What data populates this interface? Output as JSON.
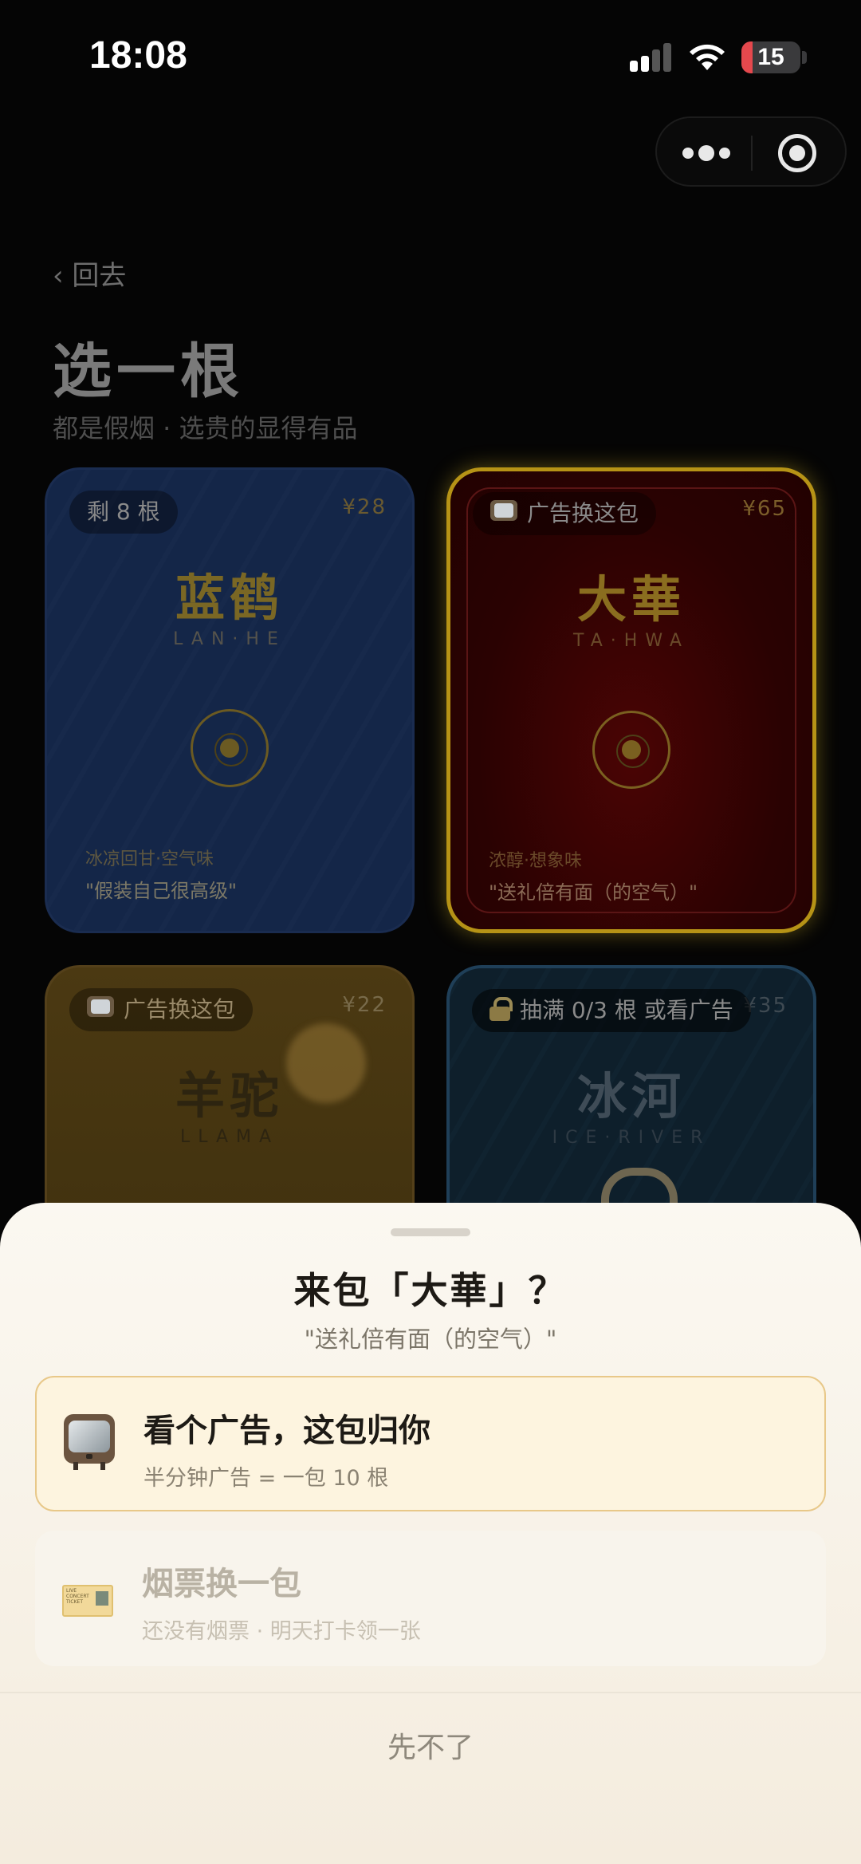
{
  "status_bar": {
    "time": "18:08",
    "battery_level": "15",
    "battery_color": "#e5484d",
    "icons": [
      "signal-icon",
      "wifi-icon",
      "battery-icon"
    ]
  },
  "capsule": {
    "icons": [
      "more-dots-icon",
      "close-target-icon"
    ]
  },
  "header": {
    "back_label": "‹ 回去",
    "title": "选一根",
    "subtitle": "都是假烟 · 选贵的显得有品"
  },
  "cards": [
    {
      "pill": "剩 8 根",
      "price": "¥28",
      "name": "蓝鹤",
      "latin": "LAN·HE",
      "flavor": "冰凉回甘·空气味",
      "quote": "\"假装自己很高级\"",
      "color": "#142648"
    },
    {
      "pill": "广告换这包",
      "pill_icon": "tv-icon",
      "price": "¥65",
      "name": "大華",
      "latin": "TA·HWA",
      "flavor": "浓醇·想象味",
      "quote": "\"送礼倍有面（的空气）\"",
      "color": "#2a0202",
      "accent": "#b69316",
      "selected": true
    },
    {
      "pill": "广告换这包",
      "pill_icon": "tv-icon",
      "price": "¥22",
      "name": "羊驼",
      "latin": "LLAMA",
      "color": "#4b3912"
    },
    {
      "pill": "抽满 0/3 根 或看广告",
      "pill_icon": "lock-icon",
      "price": "¥35",
      "name": "冰河",
      "latin": "ICE·RIVER",
      "color": "#0e1f2b",
      "locked": true
    }
  ],
  "sheet": {
    "title": "来包「大華」？",
    "subtitle": "\"送礼倍有面（的空气）\"",
    "options": [
      {
        "icon": "tv-icon",
        "title": "看个广告，这包归你",
        "desc": "半分钟广告 = 一包 10 根",
        "enabled": true
      },
      {
        "icon": "ticket-icon",
        "title": "烟票换一包",
        "desc": "还没有烟票 · 明天打卡领一张",
        "enabled": false
      }
    ],
    "cancel_label": "先不了"
  }
}
